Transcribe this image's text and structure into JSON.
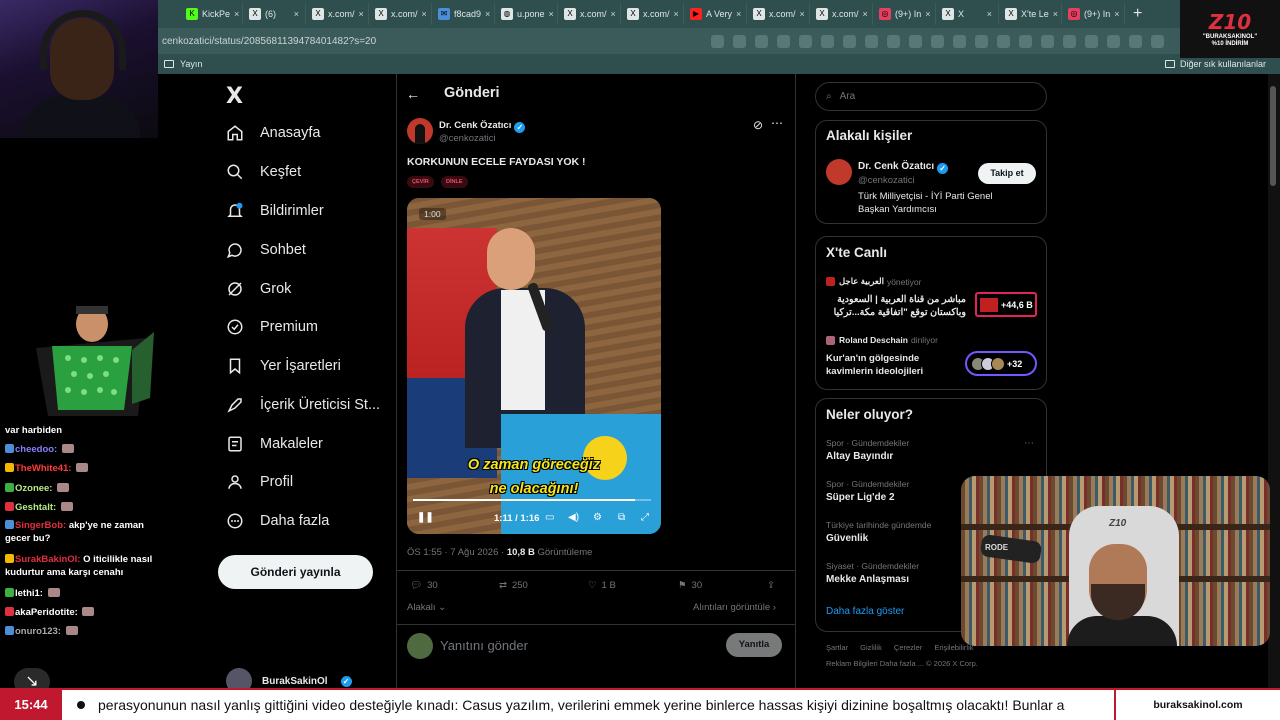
{
  "browser": {
    "tabs": [
      {
        "label": "KickPe",
        "icon": "kick-icon"
      },
      {
        "label": "(6)",
        "icon": "x-icon"
      },
      {
        "label": "x.com/",
        "icon": "x-icon"
      },
      {
        "label": "x.com/",
        "icon": "x-icon"
      },
      {
        "label": "f8cad9",
        "icon": "mail-icon"
      },
      {
        "label": "u.pone",
        "icon": "globe-icon"
      },
      {
        "label": "x.com/",
        "icon": "x-icon"
      },
      {
        "label": "x.com/",
        "icon": "x-icon"
      },
      {
        "label": "A Very",
        "icon": "youtube-icon"
      },
      {
        "label": "x.com/",
        "icon": "x-icon"
      },
      {
        "label": "x.com/",
        "icon": "x-icon"
      },
      {
        "label": "(9+) In",
        "icon": "instagram-icon"
      },
      {
        "label": "X",
        "icon": "x-icon"
      },
      {
        "label": "X'te Le",
        "icon": "x-icon"
      },
      {
        "label": "(9+) In",
        "icon": "instagram-icon"
      }
    ],
    "new_tab": "+",
    "url": "cenkozatici/status/2085681139478401482?s=20",
    "bookmarks": {
      "left": "Yayın",
      "right": "Diğer sık kullanılanlar"
    }
  },
  "brand": {
    "logo": "Z10",
    "line1": "\"BURAKSAKINOL\"",
    "line2": "%10 İNDİRİM"
  },
  "chat": [
    {
      "user": "",
      "text": "var harbiden",
      "color": "#ffffff",
      "top": 0
    },
    {
      "user": "cheedoo:",
      "text": "",
      "color": "#8a7dff"
    },
    {
      "user": "TheWhite41:",
      "text": "",
      "color": "#ff3b3b"
    },
    {
      "user": "Ozonee:",
      "text": "",
      "color": "#b8e986"
    },
    {
      "user": "Geshtalt:",
      "text": "",
      "color": "#b8e986"
    },
    {
      "user": "SingerBob:",
      "text": "akp'ye ne zaman gecer bu?",
      "color": "#e03040"
    },
    {
      "user": "SurakBakinOl:",
      "text": "O iticilikle nasıl kudurtur ama karşı cenahı",
      "color": "#e03040"
    },
    {
      "user": "lethi1:",
      "text": "",
      "color": "#ffffff"
    },
    {
      "user": "akaPeridotite:",
      "text": "",
      "color": "#ffffff"
    },
    {
      "user": "onuro123:",
      "text": "",
      "color": "#aaaaaa"
    }
  ],
  "nav": {
    "logo": "X",
    "items": [
      {
        "label": "Anasayfa",
        "icon": "home-icon"
      },
      {
        "label": "Keşfet",
        "icon": "search-icon"
      },
      {
        "label": "Bildirimler",
        "icon": "bell-icon"
      },
      {
        "label": "Sohbet",
        "icon": "chat-icon"
      },
      {
        "label": "Grok",
        "icon": "grok-icon"
      },
      {
        "label": "Premium",
        "icon": "premium-icon"
      },
      {
        "label": "Yer İşaretleri",
        "icon": "bookmark-icon"
      },
      {
        "label": "İçerik Üreticisi St...",
        "icon": "rocket-icon"
      },
      {
        "label": "Makaleler",
        "icon": "article-icon"
      },
      {
        "label": "Profil",
        "icon": "user-icon"
      },
      {
        "label": "Daha fazla",
        "icon": "more-icon"
      }
    ],
    "post_button": "Gönderi yayınla",
    "account_name": "BurakSakinOl"
  },
  "post": {
    "header_title": "Gönderi",
    "author_name": "Dr. Cenk Özatıcı",
    "author_handle": "@cenkozatici",
    "text": "KORKUNUN ECELE FAYDASI YOK !",
    "pills": [
      "ÇEVİR",
      "DİNLE"
    ],
    "video": {
      "duration_badge": "1:00",
      "subtitle_line1": "O zaman göreceğiz",
      "subtitle_line2": "ne olacağını!",
      "timer": "1:11 / 1:16",
      "progress": 0.934,
      "watermark": "İYİ PARTİ"
    },
    "meta_time": "ÖS 1:55 · 7 Ağu 2026 · ",
    "meta_views": "10,8 B",
    "meta_views_label": " Görüntüleme",
    "actions": {
      "replies": "30",
      "reposts": "250",
      "likes": "1 B",
      "bookmarks": "30"
    },
    "relevance": "Alakalı",
    "quotes_link": "Alıntıları görüntüle",
    "reply_placeholder": "Yanıtını gönder",
    "reply_button": "Yanıtla"
  },
  "sidebar": {
    "search_placeholder": "Ara",
    "related_title": "Alakalı kişiler",
    "related": {
      "name": "Dr. Cenk Özatıcı",
      "handle": "@cenkozatici",
      "bio": "Türk Milliyetçisi - İYİ Parti Genel Başkan Yardımcısı",
      "follow": "Takip et"
    },
    "live_title": "X'te Canlı",
    "live": [
      {
        "host": "العربية عاجل",
        "status": "yönetiyor",
        "title": "مباشر من قناة العربية | السعودية وباكستان توقع \"اتفاقية مكة...تركيا",
        "badge": "+44,6 B"
      },
      {
        "host": "Roland Deschain",
        "status": "dinliyor",
        "title": "Kur'an'ın gölgesinde kavimlerin ideolojileri",
        "badge": "+32"
      }
    ],
    "trends_title": "Neler oluyor?",
    "trends": [
      {
        "category": "Spor · Gündemdekiler",
        "name": "Altay Bayındır"
      },
      {
        "category": "Spor · Gündemdekiler",
        "name": "Süper Lig'de 2"
      },
      {
        "category": "Türkiye tarihinde gündemde",
        "name": "Güvenlik"
      },
      {
        "category": "Siyaset · Gündemdekiler",
        "name": "Mekke Anlaşması"
      }
    ],
    "show_more": "Daha fazla göster",
    "footer_line1": "Şartlar Gizlilik Çerezler Erişilebilirlik",
    "footer_line2": "Reklam Bilgileri   Daha fazla ...   © 2026 X Corp."
  },
  "webcam": {
    "chair_brand": "Z10",
    "mic_brand": "RODE"
  },
  "ticker": {
    "clock": "15:44",
    "text": "perasyonunun nasıl yanlış gittiğini video desteğiyle kınadı: Casus yazılım, verilerini emmek yerine binlerce hassas kişiyi dizinine boşaltmış olacaktı! Bunlar a",
    "brand": "buraksakinol.com"
  },
  "colors": {
    "x_blue": "#1d9bf0",
    "ticker_red": "#c0182e",
    "subtitle_yellow": "#f5e51a"
  }
}
